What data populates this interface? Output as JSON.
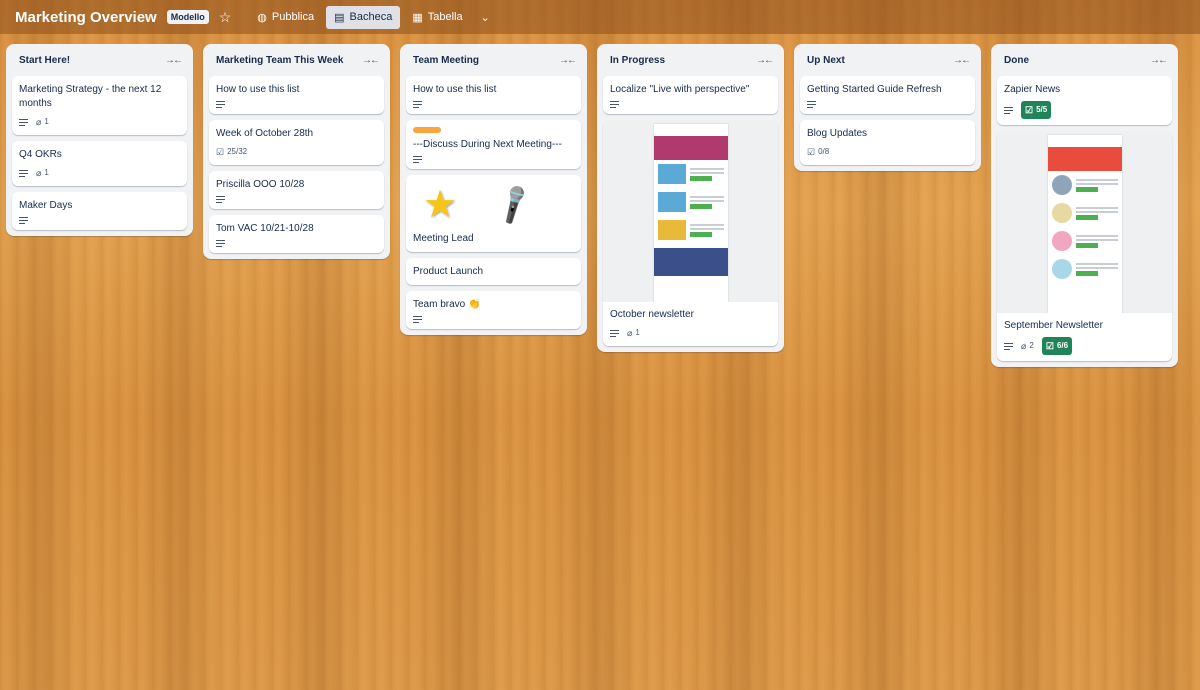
{
  "topbar": {
    "board_title": "Marketing Overview",
    "template_tag": "Modello",
    "visibility": "Pubblica",
    "view_board": "Bacheca",
    "view_table": "Tabella"
  },
  "colors": {
    "badge_complete": "#1f845a",
    "label_orange": "#faa53d",
    "list_bg": "#f1f2f4"
  },
  "lists": [
    {
      "title": "Start Here!",
      "cards": [
        {
          "title": "Marketing Strategy - the next 12 months",
          "attachments": "1"
        },
        {
          "title": "Q4 OKRs",
          "attachments": "1"
        },
        {
          "title": "Maker Days"
        }
      ]
    },
    {
      "title": "Marketing Team This Week",
      "cards": [
        {
          "title": "How to use this list"
        },
        {
          "title": "Week of October 28th",
          "checklist": "25/32"
        },
        {
          "title": "Priscilla OOO 10/28"
        },
        {
          "title": "Tom VAC 10/21-10/28"
        }
      ]
    },
    {
      "title": "Team Meeting",
      "cards": [
        {
          "title": "How to use this list"
        },
        {
          "title": "---Discuss During Next Meeting---"
        },
        {
          "title": "Meeting Lead",
          "stickers": [
            "star-icon",
            "microphone-icon"
          ]
        },
        {
          "title": "Product Launch"
        },
        {
          "title": "Team bravo 👏"
        }
      ]
    },
    {
      "title": "In Progress",
      "cards": [
        {
          "title": "Localize \"Live with perspective\""
        },
        {
          "title": "October newsletter",
          "attachments": "1"
        }
      ]
    },
    {
      "title": "Up Next",
      "cards": [
        {
          "title": "Getting Started Guide Refresh"
        },
        {
          "title": "Blog Updates",
          "checklist": "0/8"
        }
      ]
    },
    {
      "title": "Done",
      "cards": [
        {
          "title": "Zapier News",
          "checklist": "5/5"
        },
        {
          "title": "September Newsletter",
          "attachments": "2",
          "checklist": "6/6"
        }
      ]
    }
  ]
}
